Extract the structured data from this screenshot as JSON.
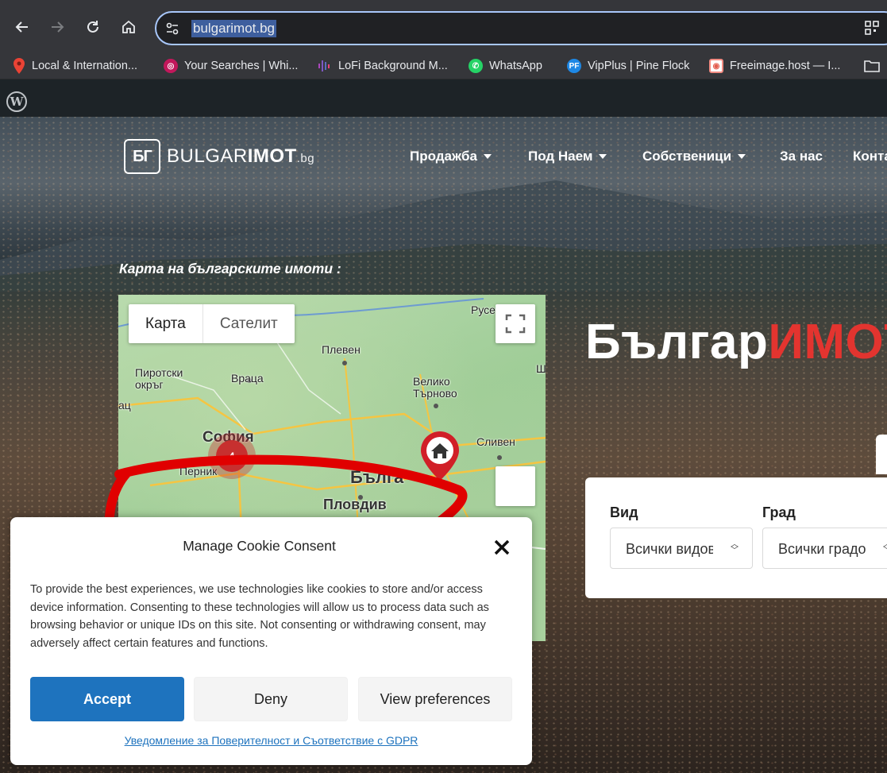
{
  "browser": {
    "url": "bulgarimot.bg",
    "bookmarks": [
      {
        "label": "Local & Internation...",
        "icon": "location-pin-icon",
        "color": "#ea4335"
      },
      {
        "label": "Your Searches | Whi...",
        "icon": "swirl-icon",
        "color": "#c2185b"
      },
      {
        "label": "LoFi Background M...",
        "icon": "audio-bars-icon",
        "color": "#7e57c2"
      },
      {
        "label": "WhatsApp",
        "icon": "whatsapp-icon",
        "color": "#25d366"
      },
      {
        "label": "VipPlus | Pine Flock",
        "icon": "pf-icon",
        "color": "#1e88e5"
      },
      {
        "label": "Freeimage.host — I...",
        "icon": "freeimage-icon",
        "color": "#f28b82"
      }
    ]
  },
  "site": {
    "logo": {
      "mark": "БГ",
      "word1": "BULGAR",
      "word2": "IMOT",
      "tld": ".bg"
    },
    "nav": [
      {
        "label": "Продажба",
        "dropdown": true
      },
      {
        "label": "Под Наем",
        "dropdown": true
      },
      {
        "label": "Собственици",
        "dropdown": true
      },
      {
        "label": "За нас",
        "dropdown": false
      },
      {
        "label": "Конта",
        "dropdown": false
      }
    ],
    "map_heading": "Карта на българските имоти :",
    "map": {
      "type_map": "Карта",
      "type_satellite": "Сателит",
      "cluster_count": "4",
      "cities": [
        {
          "name": "Плевен"
        },
        {
          "name": "Пиротски\nокръг"
        },
        {
          "name": "Враца"
        },
        {
          "name": "Велико\nТърново"
        },
        {
          "name": "Сливен"
        },
        {
          "name": "София"
        },
        {
          "name": "Перник"
        },
        {
          "name": "Пловдив"
        },
        {
          "name": "Русе"
        },
        {
          "name": "Бълга"
        },
        {
          "name": "Ш"
        },
        {
          "name": "ац"
        }
      ]
    },
    "brand_title": {
      "part1": "Българ",
      "part2": "ИМОТ",
      "part3": "."
    },
    "search": {
      "type_label": "Вид",
      "type_value": "Всички видове",
      "city_label": "Град",
      "city_value": "Всички градове"
    }
  },
  "cookie": {
    "title": "Manage Cookie Consent",
    "body": "To provide the best experiences, we use technologies like cookies to store and/or access device information. Consenting to these technologies will allow us to process data such as browsing behavior or unique IDs on this site. Not consenting or withdrawing consent, may adversely affect certain features and functions.",
    "accept": "Accept",
    "deny": "Deny",
    "preferences": "View preferences",
    "gdpr_link": "Уведомление за Поверителност и Съответствие с GDPR"
  },
  "colors": {
    "accent": "#1e73be",
    "brand_red": "#e3342f",
    "annotation_red": "#e00000"
  }
}
